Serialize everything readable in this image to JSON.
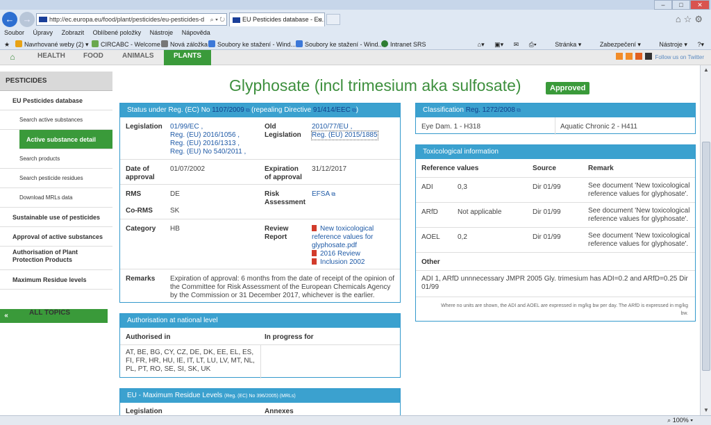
{
  "browser": {
    "url": "http://ec.europa.eu/food/plant/pesticides/eu-pesticides-d",
    "tab_title": "EU Pesticides database - Eu...",
    "menu": [
      "Soubor",
      "Úpravy",
      "Zobrazit",
      "Oblíbené položky",
      "Nástroje",
      "Nápověda"
    ],
    "favorites": [
      "Navrhované weby (2)",
      "CIRCABC - Welcome",
      "Nová záložka",
      "Soubory ke stažení - Wind...",
      "Soubory ke stažení - Wind...",
      "Intranet SRS"
    ],
    "commands": [
      "Stránka",
      "Zabezpečení",
      "Nástroje"
    ],
    "zoom": "100%"
  },
  "site_nav": {
    "items": [
      "HEALTH",
      "FOOD",
      "ANIMALS",
      "PLANTS"
    ],
    "follow": "Follow us on Twitter"
  },
  "sidebar": {
    "title": "PESTICIDES",
    "items": [
      "EU Pesticides database",
      "Search active substances",
      "Active substance detail",
      "Search products",
      "Search pesticide residues",
      "Download MRLs data",
      "Sustainable use of pesticides",
      "Approval of active substances",
      "Authorisation of Plant Protection Products",
      "Maximum Residue levels"
    ],
    "all_topics": "ALL TOPICS"
  },
  "page": {
    "title": "Glyphosate (incl trimesium aka sulfosate)",
    "badge": "Approved"
  },
  "status": {
    "head_text": "Status under Reg. (EC) No",
    "head_link1": "1107/2009",
    "head_mid": "(repealing Directive",
    "head_link2": "91/414/EEC",
    "legislation_label": "Legislation",
    "legislation": [
      "01/99/EC ,",
      "Reg. (EU) 2016/1056 ,",
      "Reg. (EU) 2016/1313 ,",
      "Reg. (EU) No 540/2011 ,"
    ],
    "old_label": "Old Legislation",
    "old_legislation": [
      "2010/77/EU ,",
      "Reg. (EU) 2015/1885"
    ],
    "approval_label": "Date of approval",
    "approval": "01/07/2002",
    "expiration_label": "Expiration of approval",
    "expiration": "31/12/2017",
    "rms_label": "RMS",
    "rms": "DE",
    "corms_label": "Co-RMS",
    "corms": "SK",
    "risk_label": "Risk Assessment",
    "risk": "EFSA",
    "category_label": "Category",
    "category": "HB",
    "review_label": "Review Report",
    "review": [
      "New toxicological reference values for glyphosate.pdf",
      "2016 Review",
      "Inclusion 2002"
    ],
    "remarks_label": "Remarks",
    "remarks": "Expiration of approval: 6 months from the date of receipt of the opinion of the Committee for Risk Assessment of the European Chemicals Agency by the Commission or 31 December 2017, whichever is the earlier."
  },
  "authorisation": {
    "head": "Authorisation at national level",
    "col1": "Authorised in",
    "col2": "In progress for",
    "countries": "AT, BE, BG, CY, CZ, DE, DK, EE, EL, ES, FI, FR, HR, HU, IE, IT, LT, LU, LV, MT, NL, PL, PT, RO, SE, SI, SK, UK"
  },
  "mrl": {
    "head": "EU - Maximum Residue Levels",
    "head_small": "(Reg. (EC) No 396/2005) (MRLs)",
    "col1": "Legislation",
    "col2": "Annexes"
  },
  "classification": {
    "head_text": "Classification",
    "head_link": "Reg. 1272/2008",
    "left": "Eye Dam. 1 - H318",
    "right": "Aquatic Chronic 2 - H411"
  },
  "tox": {
    "head": "Toxicological information",
    "cols": [
      "Reference values",
      "Source",
      "Remark"
    ],
    "rows": [
      {
        "name": "ADI",
        "value": "0,3",
        "source": "Dir 01/99",
        "remark": "See document 'New toxicological reference values for glyphosate'."
      },
      {
        "name": "ARfD",
        "value": "Not applicable",
        "source": "Dir 01/99",
        "remark": "See document 'New toxicological reference values for glyphosate'."
      },
      {
        "name": "AOEL",
        "value": "0,2",
        "source": "Dir 01/99",
        "remark": "See document 'New toxicological reference values for glyphosate'."
      }
    ],
    "other_label": "Other",
    "other": "ADI 1, ARfD unnnecessary JMPR 2005 Gly. trimesium has ADI=0.2 and ARfD=0.25 Dir 01/99",
    "note": "Where no units are shown, the ADI and AOEL are expressed in mg/kg bw per day. The ARfD is expressed in mg/kg bw."
  }
}
